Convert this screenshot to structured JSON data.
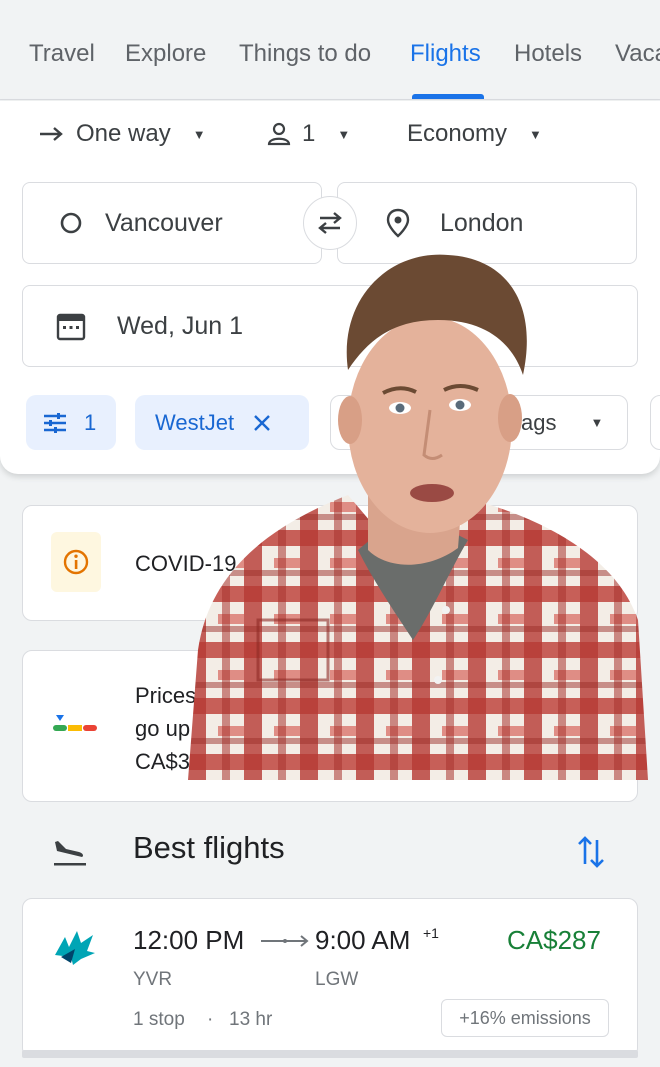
{
  "nav": {
    "tabs": [
      {
        "label": "Travel"
      },
      {
        "label": "Explore"
      },
      {
        "label": "Things to do"
      },
      {
        "label": "Flights"
      },
      {
        "label": "Hotels"
      },
      {
        "label": "Vaca"
      }
    ],
    "active_tab": "Flights"
  },
  "search": {
    "trip_type": "One way",
    "passengers": "1",
    "cabin_class": "Economy",
    "origin": "Vancouver",
    "destination": "London",
    "date": "Wed, Jun 1",
    "filters": {
      "all_filters_count": "1",
      "airline_chip": "WestJet",
      "bags_chip": "ags"
    }
  },
  "notices": {
    "covid_text": "COVID-19",
    "price_text_lines": [
      "Prices",
      "go up",
      "CA$3"
    ]
  },
  "results": {
    "section_title": "Best flights",
    "flights": [
      {
        "depart_time": "12:00 PM",
        "arrive_time": "9:00 AM",
        "day_offset": "+1",
        "price": "CA$287",
        "from_code": "YVR",
        "to_code": "LGW",
        "stops": "1 stop",
        "separator": "·",
        "duration": "13 hr",
        "emissions": "+16% emissions"
      }
    ]
  },
  "colors": {
    "accent": "#1a73e8",
    "price_green": "#188038",
    "chip_bg": "#e8f0fe",
    "info_bg": "#fef7e0",
    "info_icon": "#e37400"
  },
  "icons": {
    "trip_type": "arrow-right-icon",
    "passengers": "person-icon",
    "origin": "circle-icon",
    "swap": "swap-icon",
    "destination": "location-pin-icon",
    "date": "calendar-icon",
    "filters": "tune-icon",
    "remove_chip": "close-icon",
    "covid": "info-icon",
    "price_insight": "price-level-icon",
    "best_flights": "plane-landing-icon",
    "sort": "sort-arrows-icon",
    "airline": "westjet-logo"
  }
}
